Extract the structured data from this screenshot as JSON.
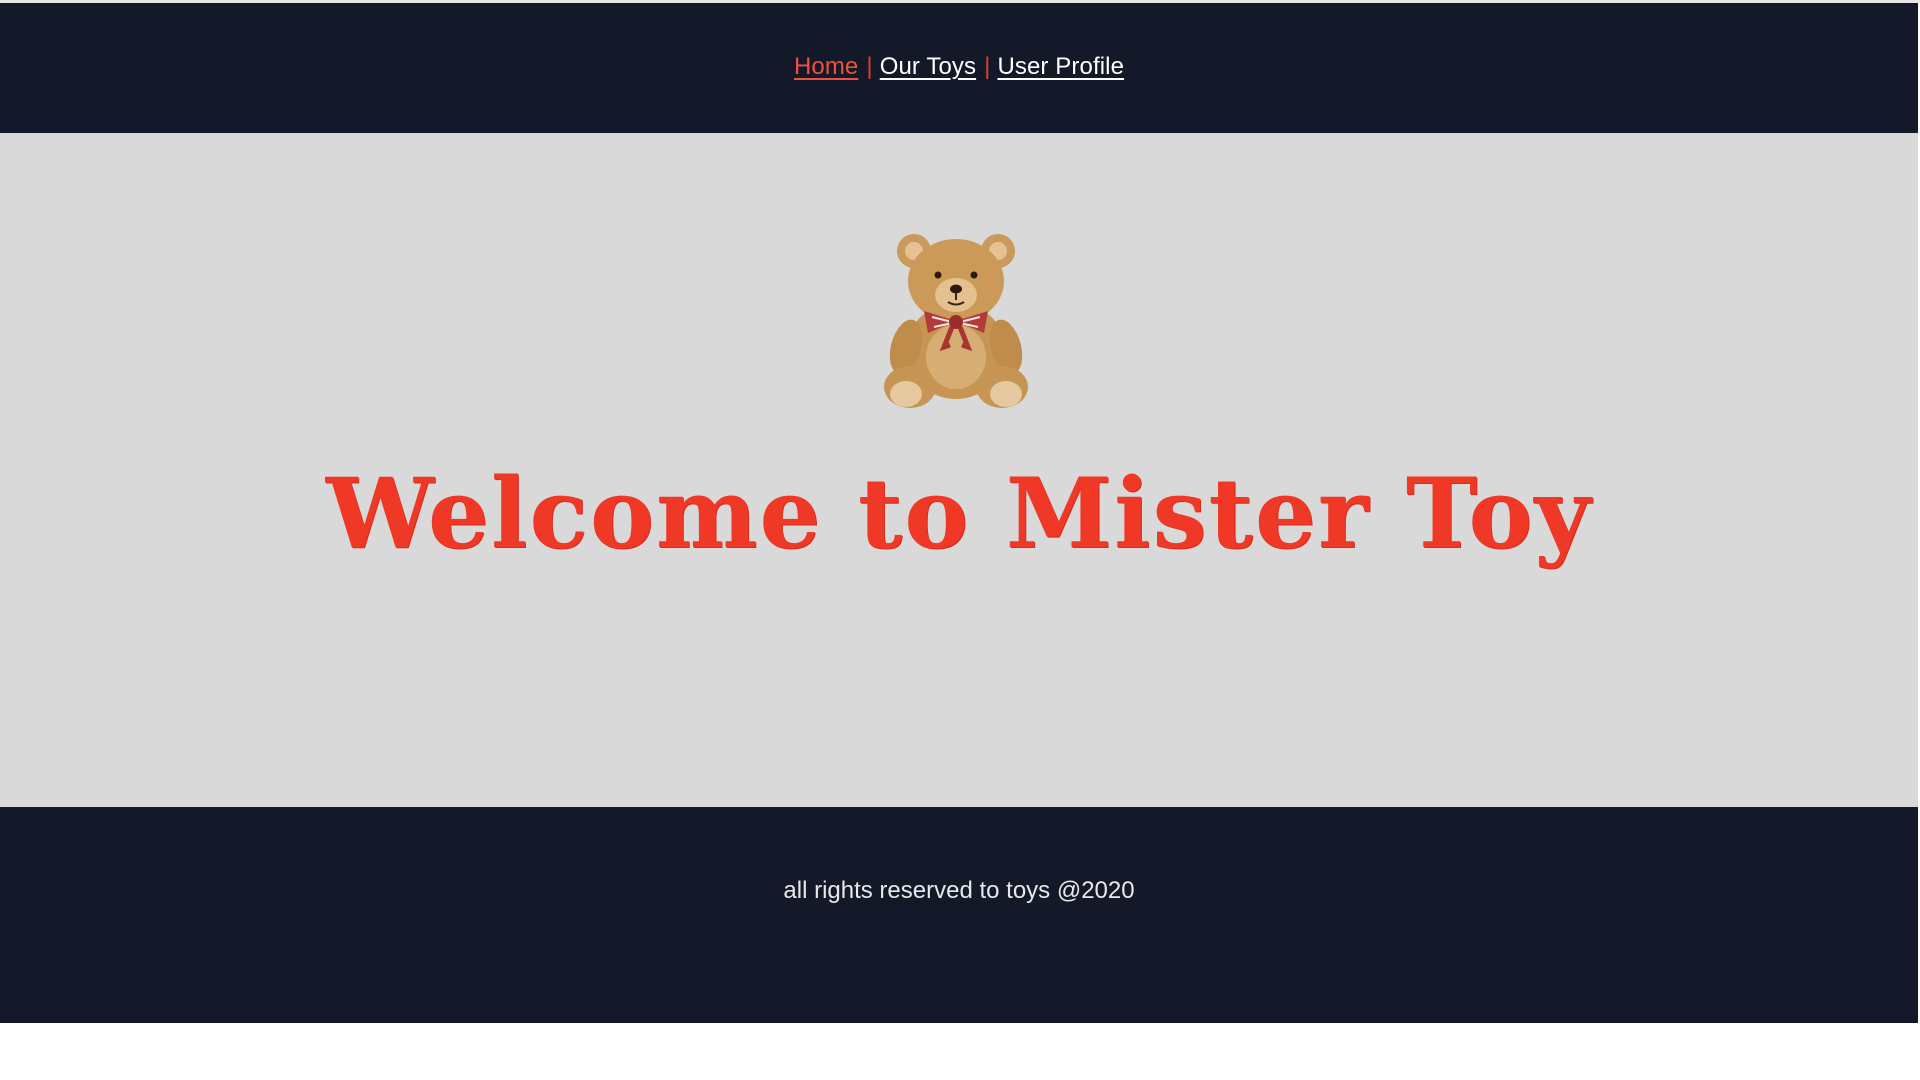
{
  "nav": {
    "items": [
      {
        "label": "Home",
        "active": true
      },
      {
        "label": "Our Toys",
        "active": false
      },
      {
        "label": "User Profile",
        "active": false
      }
    ],
    "separator": "|"
  },
  "hero": {
    "image": "teddy-bear",
    "title": "Welcome to Mister Toy"
  },
  "footer": {
    "text": "all rights reserved to toys @2020"
  },
  "colors": {
    "header_bg": "#131929",
    "main_bg": "#d9d9d9",
    "accent": "#f03826",
    "link": "#ffffff"
  }
}
